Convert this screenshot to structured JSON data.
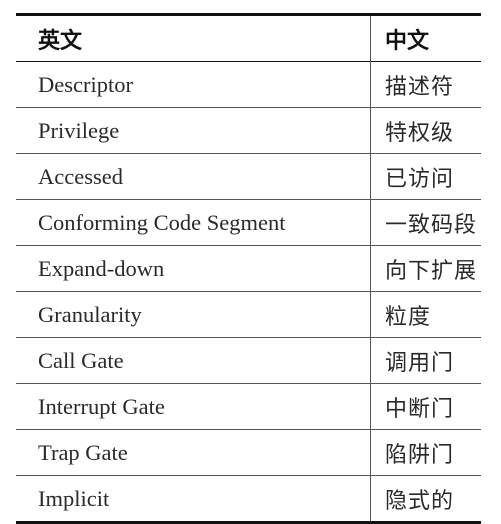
{
  "table": {
    "headers": {
      "english": "英文",
      "chinese": "中文"
    },
    "rows": [
      {
        "english": "Descriptor",
        "chinese": "描述符"
      },
      {
        "english": "Privilege",
        "chinese": "特权级"
      },
      {
        "english": "Accessed",
        "chinese": "已访问"
      },
      {
        "english": "Conforming Code Segment",
        "chinese": "一致码段"
      },
      {
        "english": "Expand-down",
        "chinese": "向下扩展"
      },
      {
        "english": "Granularity",
        "chinese": "粒度"
      },
      {
        "english": "Call Gate",
        "chinese": "调用门"
      },
      {
        "english": "Interrupt Gate",
        "chinese": "中断门"
      },
      {
        "english": "Trap Gate",
        "chinese": "陷阱门"
      },
      {
        "english": "Implicit",
        "chinese": "隐式的"
      }
    ]
  }
}
